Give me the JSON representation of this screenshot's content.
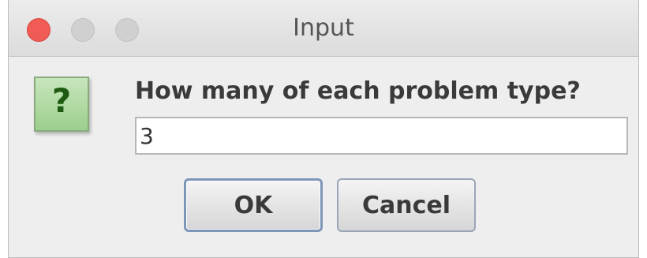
{
  "window": {
    "title": "Input"
  },
  "dialog": {
    "icon": "question-icon",
    "icon_glyph": "?",
    "prompt": "How many of each problem type?",
    "input_value": "3",
    "ok_label": "OK",
    "cancel_label": "Cancel"
  },
  "colors": {
    "close_button": "#f15b55",
    "icon_background": "#9ccf8c",
    "icon_glyph": "#1f5a12",
    "default_button_border": "#7d95b7"
  }
}
